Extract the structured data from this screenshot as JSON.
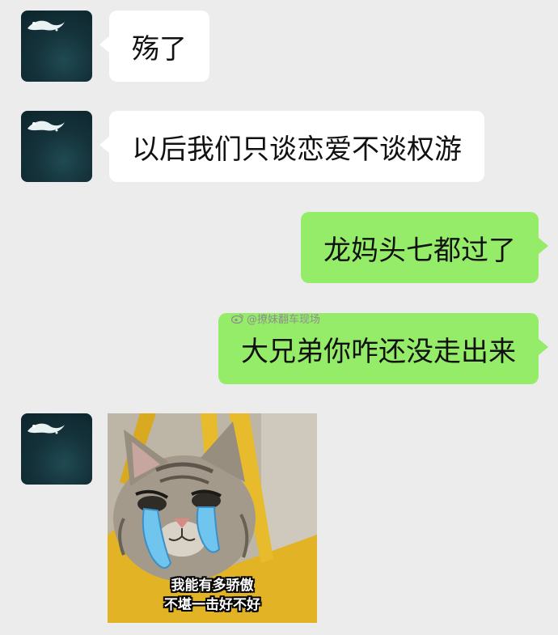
{
  "messages": [
    {
      "side": "left",
      "text": "殇了"
    },
    {
      "side": "left",
      "text": "以后我们只谈恋爱不谈权游"
    },
    {
      "side": "right",
      "text": "龙妈头七都过了"
    },
    {
      "side": "right",
      "text": "大兄弟你咋还没走出来"
    }
  ],
  "watermark": {
    "text": "@撩妹翻车现场",
    "icon": "weibo-icon"
  },
  "sticker": {
    "caption_line1": "我能有多骄傲",
    "caption_line2": "不堪一击好不好",
    "icon": "crying-cat-sticker"
  },
  "colors": {
    "background": "#ececec",
    "sent_bubble": "#95ec69",
    "received_bubble": "#ffffff"
  }
}
